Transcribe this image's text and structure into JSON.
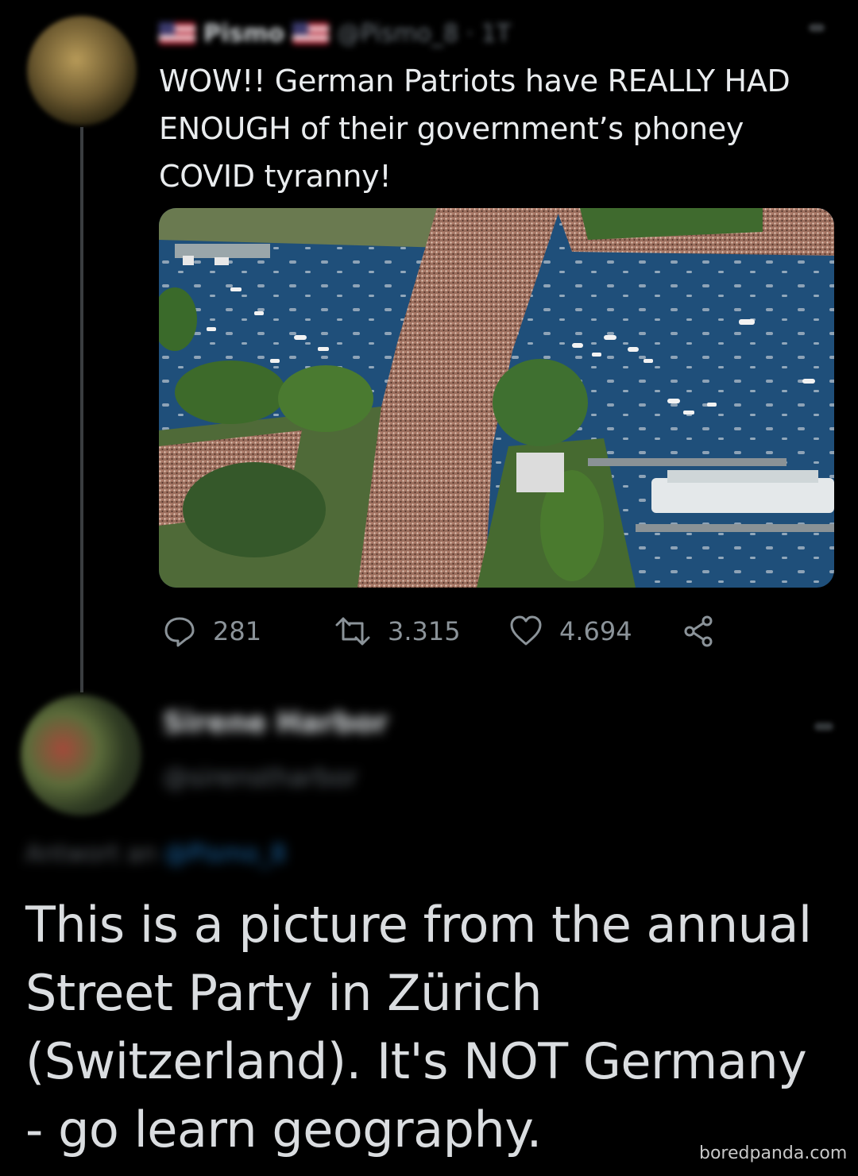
{
  "tweet": {
    "display_name": "Pismo",
    "handle": "@Pismo_8 · 1T",
    "text": "WOW!! German Patriots have REALLY HAD ENOUGH of their government’s phoney COVID tyranny!",
    "actions": {
      "reply_count": "281",
      "retweet_count": "3.315",
      "like_count": "4.694"
    }
  },
  "reply": {
    "display_name": "Sirene Harbor",
    "handle": "@sirenstharbor",
    "answer_prefix": "Antwort an",
    "answer_mention": "@Pismo_8",
    "text": "This is a picture from the annual Street Party in Zürich (Switzerland). It's NOT Germany - go learn geography."
  },
  "watermark": "boredpanda.com",
  "colors": {
    "background": "#000000",
    "text": "#e7e9ea",
    "muted": "#8b9399",
    "mention": "#1d6fb3"
  },
  "icons": [
    "reply-icon",
    "retweet-icon",
    "like-icon",
    "share-icon"
  ]
}
